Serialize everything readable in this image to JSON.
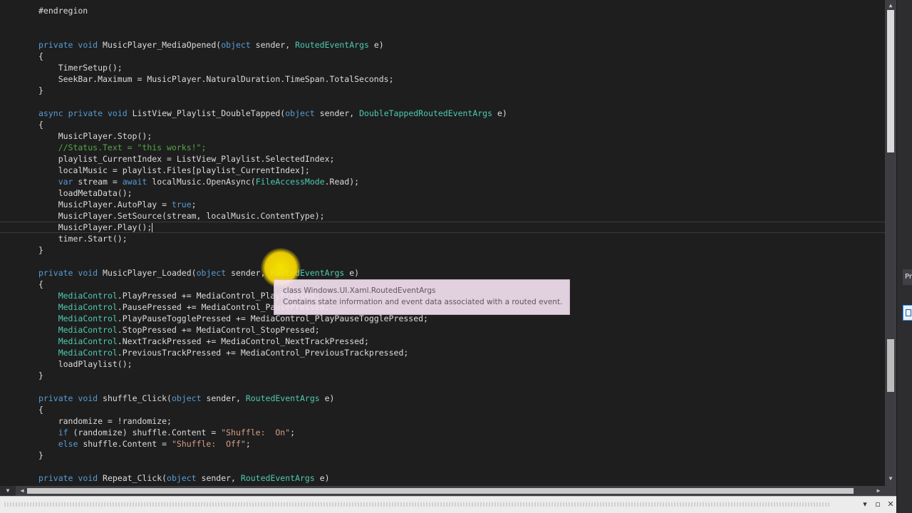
{
  "editor": {
    "lines": [
      [
        {
          "t": "#endregion",
          "c": "plain"
        }
      ],
      [],
      [],
      [
        {
          "t": "private",
          "c": "keyword"
        },
        {
          "t": " ",
          "c": "plain"
        },
        {
          "t": "void",
          "c": "keyword"
        },
        {
          "t": " MusicPlayer_MediaOpened(",
          "c": "plain"
        },
        {
          "t": "object",
          "c": "keyword"
        },
        {
          "t": " sender, ",
          "c": "plain"
        },
        {
          "t": "RoutedEventArgs",
          "c": "type"
        },
        {
          "t": " e)",
          "c": "plain"
        }
      ],
      [
        {
          "t": "{",
          "c": "plain"
        }
      ],
      [
        {
          "t": "    TimerSetup();",
          "c": "plain"
        }
      ],
      [
        {
          "t": "    SeekBar.Maximum = MusicPlayer.NaturalDuration.TimeSpan.TotalSeconds;",
          "c": "plain"
        }
      ],
      [
        {
          "t": "}",
          "c": "plain"
        }
      ],
      [],
      [
        {
          "t": "async",
          "c": "keyword"
        },
        {
          "t": " ",
          "c": "plain"
        },
        {
          "t": "private",
          "c": "keyword"
        },
        {
          "t": " ",
          "c": "plain"
        },
        {
          "t": "void",
          "c": "keyword"
        },
        {
          "t": " ListView_Playlist_DoubleTapped(",
          "c": "plain"
        },
        {
          "t": "object",
          "c": "keyword"
        },
        {
          "t": " sender, ",
          "c": "plain"
        },
        {
          "t": "DoubleTappedRoutedEventArgs",
          "c": "type"
        },
        {
          "t": " e)",
          "c": "plain"
        }
      ],
      [
        {
          "t": "{",
          "c": "plain"
        }
      ],
      [
        {
          "t": "    MusicPlayer.Stop();",
          "c": "plain"
        }
      ],
      [
        {
          "t": "    //Status.Text = \"this works!\";",
          "c": "comment"
        }
      ],
      [
        {
          "t": "    playlist_CurrentIndex = ListView_Playlist.SelectedIndex;",
          "c": "plain"
        }
      ],
      [
        {
          "t": "    localMusic = playlist.Files[playlist_CurrentIndex];",
          "c": "plain"
        }
      ],
      [
        {
          "t": "    ",
          "c": "plain"
        },
        {
          "t": "var",
          "c": "keyword"
        },
        {
          "t": " stream = ",
          "c": "plain"
        },
        {
          "t": "await",
          "c": "keyword"
        },
        {
          "t": " localMusic.OpenAsync(",
          "c": "plain"
        },
        {
          "t": "FileAccessMode",
          "c": "type"
        },
        {
          "t": ".Read);",
          "c": "plain"
        }
      ],
      [
        {
          "t": "    loadMetaData();",
          "c": "plain"
        }
      ],
      [
        {
          "t": "    MusicPlayer.AutoPlay = ",
          "c": "plain"
        },
        {
          "t": "true",
          "c": "keyword"
        },
        {
          "t": ";",
          "c": "plain"
        }
      ],
      [
        {
          "t": "    MusicPlayer.SetSource(stream, localMusic.ContentType);",
          "c": "plain"
        }
      ],
      [
        {
          "t": "    MusicPlayer.Play();",
          "c": "plain"
        }
      ],
      [
        {
          "t": "    timer.Start();",
          "c": "plain"
        }
      ],
      [
        {
          "t": "}",
          "c": "plain"
        }
      ],
      [],
      [
        {
          "t": "private",
          "c": "keyword"
        },
        {
          "t": " ",
          "c": "plain"
        },
        {
          "t": "void",
          "c": "keyword"
        },
        {
          "t": " MusicPlayer_Loaded(",
          "c": "plain"
        },
        {
          "t": "object",
          "c": "keyword"
        },
        {
          "t": " sender, ",
          "c": "plain"
        },
        {
          "t": "RoutedEventArgs",
          "c": "type"
        },
        {
          "t": " e)",
          "c": "plain"
        }
      ],
      [
        {
          "t": "{",
          "c": "plain"
        }
      ],
      [
        {
          "t": "    ",
          "c": "plain"
        },
        {
          "t": "MediaControl",
          "c": "type"
        },
        {
          "t": ".PlayPressed += MediaControl_PlayPressed;",
          "c": "plain"
        }
      ],
      [
        {
          "t": "    ",
          "c": "plain"
        },
        {
          "t": "MediaControl",
          "c": "type"
        },
        {
          "t": ".PausePressed += MediaControl_PausePressed;",
          "c": "plain"
        }
      ],
      [
        {
          "t": "    ",
          "c": "plain"
        },
        {
          "t": "MediaControl",
          "c": "type"
        },
        {
          "t": ".PlayPauseTogglePressed += MediaControl_PlayPauseTogglePressed;",
          "c": "plain"
        }
      ],
      [
        {
          "t": "    ",
          "c": "plain"
        },
        {
          "t": "MediaControl",
          "c": "type"
        },
        {
          "t": ".StopPressed += MediaControl_StopPressed;",
          "c": "plain"
        }
      ],
      [
        {
          "t": "    ",
          "c": "plain"
        },
        {
          "t": "MediaControl",
          "c": "type"
        },
        {
          "t": ".NextTrackPressed += MediaControl_NextTrackPressed;",
          "c": "plain"
        }
      ],
      [
        {
          "t": "    ",
          "c": "plain"
        },
        {
          "t": "MediaControl",
          "c": "type"
        },
        {
          "t": ".PreviousTrackPressed += MediaControl_PreviousTrackpressed;",
          "c": "plain"
        }
      ],
      [
        {
          "t": "    loadPlaylist();",
          "c": "plain"
        }
      ],
      [
        {
          "t": "}",
          "c": "plain"
        }
      ],
      [],
      [
        {
          "t": "private",
          "c": "keyword"
        },
        {
          "t": " ",
          "c": "plain"
        },
        {
          "t": "void",
          "c": "keyword"
        },
        {
          "t": " shuffle_Click(",
          "c": "plain"
        },
        {
          "t": "object",
          "c": "keyword"
        },
        {
          "t": " sender, ",
          "c": "plain"
        },
        {
          "t": "RoutedEventArgs",
          "c": "type"
        },
        {
          "t": " e)",
          "c": "plain"
        }
      ],
      [
        {
          "t": "{",
          "c": "plain"
        }
      ],
      [
        {
          "t": "    randomize = !randomize;",
          "c": "plain"
        }
      ],
      [
        {
          "t": "    ",
          "c": "plain"
        },
        {
          "t": "if",
          "c": "keyword"
        },
        {
          "t": " (randomize) shuffle.Content = ",
          "c": "plain"
        },
        {
          "t": "\"Shuffle:  On\"",
          "c": "string"
        },
        {
          "t": ";",
          "c": "plain"
        }
      ],
      [
        {
          "t": "    ",
          "c": "plain"
        },
        {
          "t": "else",
          "c": "keyword"
        },
        {
          "t": " shuffle.Content = ",
          "c": "plain"
        },
        {
          "t": "\"Shuffle:  Off\"",
          "c": "string"
        },
        {
          "t": ";",
          "c": "plain"
        }
      ],
      [
        {
          "t": "}",
          "c": "plain"
        }
      ],
      [],
      [
        {
          "t": "private",
          "c": "keyword"
        },
        {
          "t": " ",
          "c": "plain"
        },
        {
          "t": "void",
          "c": "keyword"
        },
        {
          "t": " Repeat_Click(",
          "c": "plain"
        },
        {
          "t": "object",
          "c": "keyword"
        },
        {
          "t": " sender, ",
          "c": "plain"
        },
        {
          "t": "RoutedEventArgs",
          "c": "type"
        },
        {
          "t": " e)",
          "c": "plain"
        }
      ]
    ],
    "current_line": 19
  },
  "tooltip": {
    "line1": "class Windows.UI.Xaml.RoutedEventArgs",
    "line2": "Contains state information and event data associated with a routed event."
  },
  "right_panel": {
    "tab_label": "Pr"
  },
  "icons": {
    "scroll_up": "scroll-up-arrow-icon",
    "scroll_down": "scroll-down-arrow-icon",
    "scroll_left": "scroll-left-arrow-icon",
    "scroll_right": "scroll-right-arrow-icon",
    "zoom": "zoom-dropdown-icon",
    "minimize": "minimize-icon",
    "restore": "restore-icon",
    "close": "close-icon"
  },
  "colors": {
    "editor_background": "#1e1e1e",
    "keyword": "#569cd6",
    "type": "#4ec9b0",
    "comment": "#57a64a",
    "string": "#d69d85",
    "plain": "#dcdcdc",
    "tooltip_background": "#f7e4f2",
    "cursor_highlight": "#ffe600"
  }
}
